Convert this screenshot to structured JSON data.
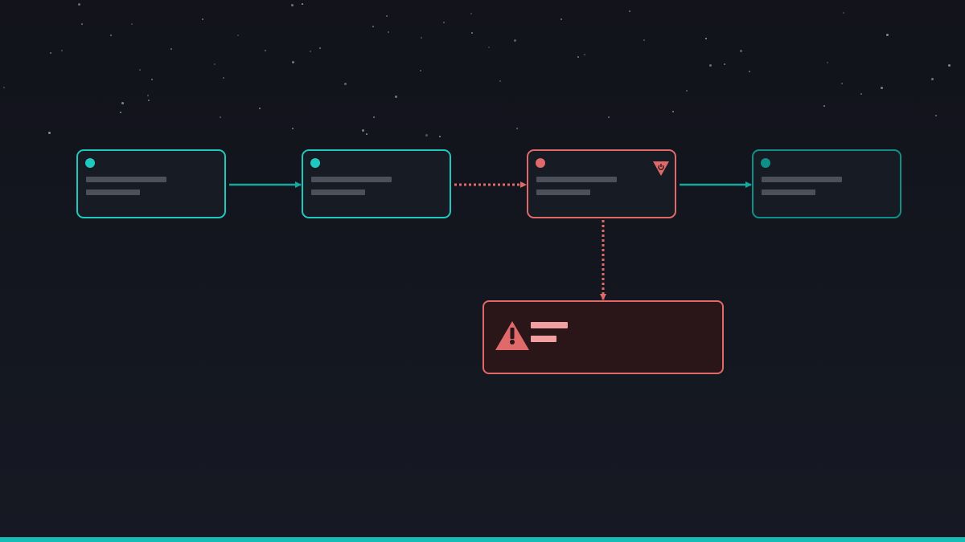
{
  "colors": {
    "background": "#13151d",
    "ok_border": "#1fc9c0",
    "muted_border": "#0f9089",
    "error_border": "#e06a6a",
    "error_fill": "#2a1518",
    "skeleton_line": "#4b505b",
    "error_line": "#f0a0a0",
    "footer_bar": "#14bdb5"
  },
  "pipeline": {
    "nodes": [
      {
        "id": "node-1",
        "status": "success"
      },
      {
        "id": "node-2",
        "status": "success"
      },
      {
        "id": "node-3",
        "status": "error"
      },
      {
        "id": "node-4",
        "status": "inactive"
      }
    ],
    "edges": [
      {
        "from": "node-1",
        "to": "node-2",
        "style": "solid"
      },
      {
        "from": "node-2",
        "to": "node-3",
        "style": "dotted"
      },
      {
        "from": "node-3",
        "to": "node-4",
        "style": "solid"
      },
      {
        "from": "node-3",
        "to": "error-box",
        "style": "dotted"
      }
    ]
  },
  "icons": {
    "node_error_badge": "error-badge-icon",
    "error_panel": "warning-triangle-icon"
  }
}
